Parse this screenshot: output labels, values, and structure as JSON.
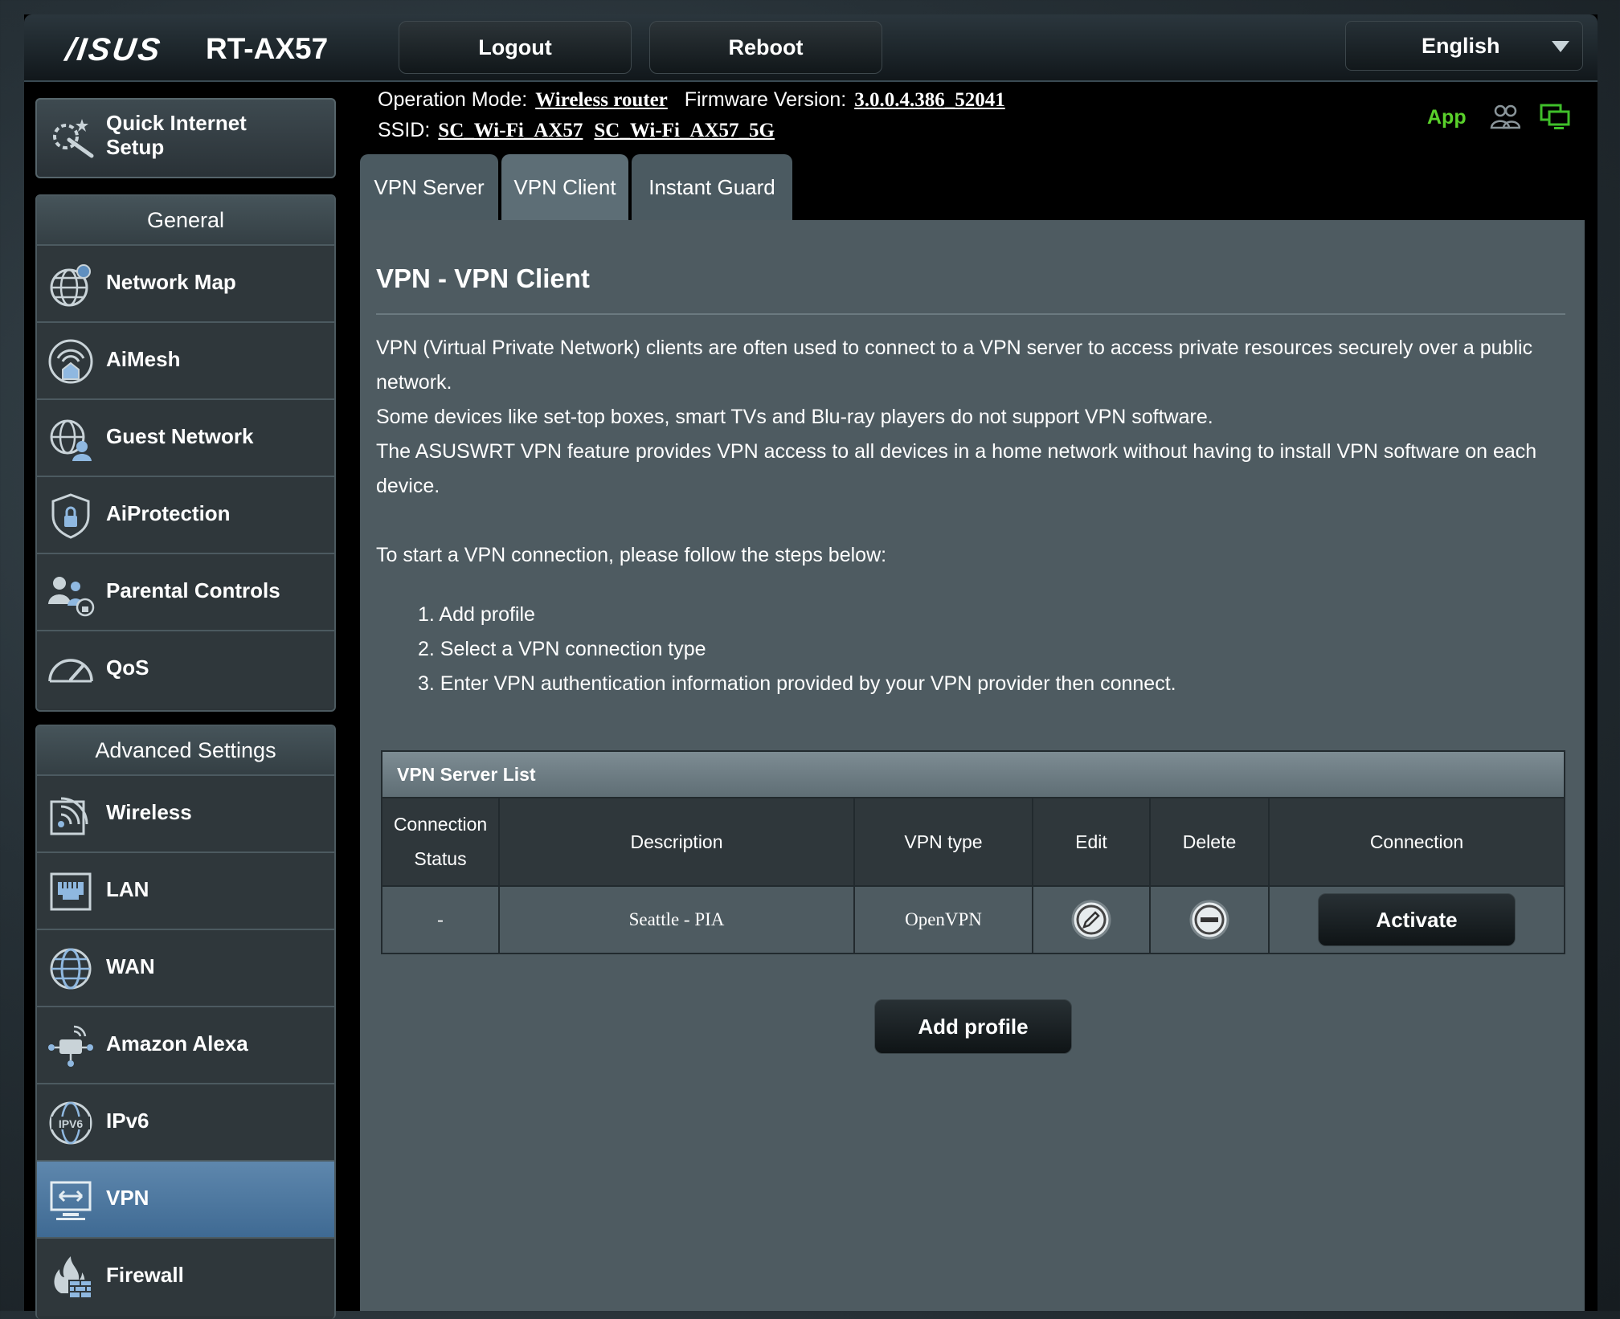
{
  "header": {
    "brand": "/ISUS",
    "model": "RT-AX57",
    "logout_label": "Logout",
    "reboot_label": "Reboot",
    "language": "English"
  },
  "info": {
    "operation_mode_label": "Operation Mode:",
    "operation_mode_value": "Wireless router",
    "firmware_label": "Firmware Version:",
    "firmware_value": "3.0.0.4.386_52041",
    "ssid_label": "SSID:",
    "ssid_1": "SC_Wi-Fi_AX57",
    "ssid_2": "SC_Wi-Fi_AX57_5G",
    "app_label": "App"
  },
  "tabs": [
    {
      "label": "VPN Server"
    },
    {
      "label": "VPN Client"
    },
    {
      "label": "Instant Guard"
    }
  ],
  "main": {
    "title": "VPN - VPN Client",
    "paragraphs": [
      "VPN (Virtual Private Network) clients are often used to connect to a VPN server to access private resources securely over a public network.",
      "Some devices like set-top boxes, smart TVs and Blu-ray players do not support VPN software.",
      "The ASUSWRT VPN feature provides VPN access to all devices in a home network without having to install VPN software on each device."
    ],
    "steps_intro": "To start a VPN connection, please follow the steps below:",
    "steps": [
      "1. Add profile",
      "2. Select a VPN connection type",
      "3. Enter VPN authentication information provided by your VPN provider then connect."
    ],
    "add_profile_label": "Add profile"
  },
  "vpn_table": {
    "title": "VPN Server List",
    "columns": [
      "Connection Status",
      "Description",
      "VPN type",
      "Edit",
      "Delete",
      "Connection"
    ],
    "rows": [
      {
        "status": "-",
        "description": "Seattle - PIA",
        "vpn_type": "OpenVPN",
        "action": "Activate"
      }
    ]
  },
  "sidebar": {
    "quick_setup": "Quick Internet Setup",
    "general_header": "General",
    "general_items": [
      {
        "label": "Network Map",
        "icon": "network-map-icon"
      },
      {
        "label": "AiMesh",
        "icon": "aimesh-icon"
      },
      {
        "label": "Guest Network",
        "icon": "guest-network-icon"
      },
      {
        "label": "AiProtection",
        "icon": "aiprotection-icon"
      },
      {
        "label": "Parental Controls",
        "icon": "parental-controls-icon"
      },
      {
        "label": "QoS",
        "icon": "qos-icon"
      }
    ],
    "advanced_header": "Advanced Settings",
    "advanced_items": [
      {
        "label": "Wireless",
        "icon": "wireless-icon"
      },
      {
        "label": "LAN",
        "icon": "lan-icon"
      },
      {
        "label": "WAN",
        "icon": "wan-icon"
      },
      {
        "label": "Amazon Alexa",
        "icon": "alexa-icon"
      },
      {
        "label": "IPv6",
        "icon": "ipv6-icon"
      },
      {
        "label": "VPN",
        "icon": "vpn-icon"
      },
      {
        "label": "Firewall",
        "icon": "firewall-icon"
      }
    ]
  },
  "colors": {
    "accent_green": "#5ad12b",
    "active_blue": "#4f7aa3",
    "panel": "#4e5b61"
  }
}
